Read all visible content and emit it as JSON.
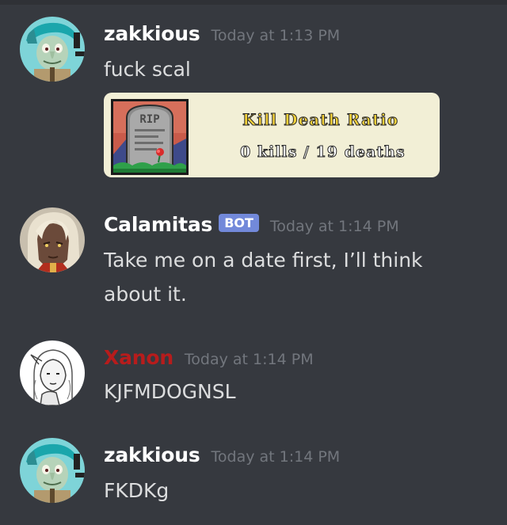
{
  "colors": {
    "background": "#36393f",
    "username": "#ffffff",
    "timestamp": "#72767d",
    "message_text": "#dcddde",
    "bot_badge": "#7289da",
    "xanon_role": "#b71c1c",
    "embed_bg": "#f2efd6"
  },
  "messages": [
    {
      "username": "zakkious",
      "timestamp": "Today at 1:13 PM",
      "text": "fuck scal",
      "avatar": "squidward-green-hair-avatar",
      "embed": {
        "image": "tombstone-rip-image",
        "tombstone_text": "RIP",
        "title": "Kill Death Ratio",
        "subtitle": "0 kills / 19 deaths"
      }
    },
    {
      "username": "Calamitas",
      "badge": "BOT",
      "timestamp": "Today at 1:14 PM",
      "text_line1": "Take me on a date first, I’ll think",
      "text_line2": "about it.",
      "avatar": "calamitas-character-avatar"
    },
    {
      "username": "Xanon",
      "timestamp": "Today at 1:14 PM",
      "text": "KJFMDOGNSL",
      "avatar": "sketch-character-avatar"
    },
    {
      "username": "zakkious",
      "timestamp": "Today at 1:14 PM",
      "text": "FKDKg",
      "avatar": "squidward-green-hair-avatar"
    }
  ]
}
